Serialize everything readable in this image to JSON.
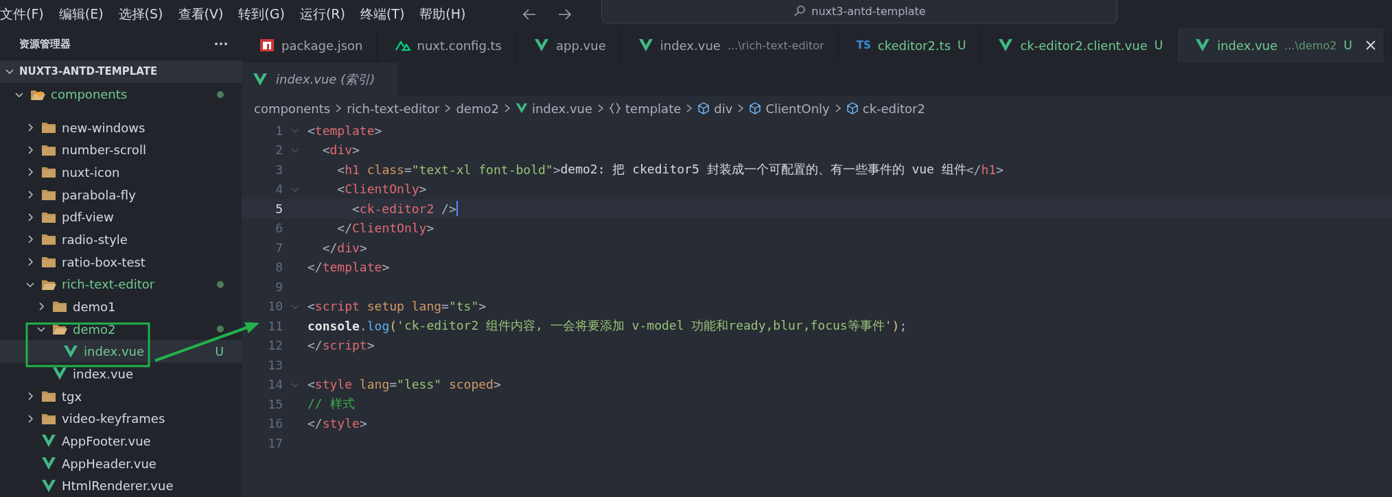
{
  "menu": [
    "文件(F)",
    "编辑(E)",
    "选择(S)",
    "查看(V)",
    "转到(G)",
    "运行(R)",
    "终端(T)",
    "帮助(H)"
  ],
  "search": {
    "value": "nuxt3-antd-template"
  },
  "sidebar": {
    "title": "资源管理器",
    "workspace": {
      "label": "NUXT3-ANTD-TEMPLATE",
      "expanded": true
    },
    "items": [
      {
        "label": "components",
        "kind": "special-folder",
        "expanded": true,
        "untracked": true,
        "dot": true,
        "selected": false,
        "children": [
          {
            "label": "new-windows",
            "kind": "folder",
            "expanded": false,
            "untracked": false,
            "selected": false
          },
          {
            "label": "number-scroll",
            "kind": "folder",
            "expanded": false,
            "untracked": false,
            "selected": false
          },
          {
            "label": "nuxt-icon",
            "kind": "folder",
            "expanded": false,
            "untracked": false,
            "selected": false
          },
          {
            "label": "parabola-fly",
            "kind": "folder",
            "expanded": false,
            "untracked": false,
            "selected": false
          },
          {
            "label": "pdf-view",
            "kind": "folder",
            "expanded": false,
            "untracked": false,
            "selected": false
          },
          {
            "label": "radio-style",
            "kind": "folder",
            "expanded": false,
            "untracked": false,
            "selected": false
          },
          {
            "label": "ratio-box-test",
            "kind": "folder",
            "expanded": false,
            "untracked": false,
            "selected": false
          },
          {
            "label": "rich-text-editor",
            "kind": "folder",
            "expanded": true,
            "untracked": true,
            "dot": true,
            "selected": false,
            "children": [
              {
                "label": "demo1",
                "kind": "folder",
                "expanded": false,
                "untracked": false,
                "selected": false
              },
              {
                "label": "demo2",
                "kind": "folder",
                "expanded": true,
                "untracked": true,
                "dot": true,
                "selected": false,
                "children": [
                  {
                    "label": "index.vue",
                    "kind": "vue",
                    "untracked": true,
                    "badge": "U",
                    "selected": true
                  }
                ]
              },
              {
                "label": "index.vue",
                "kind": "vue",
                "untracked": false,
                "selected": false
              }
            ]
          },
          {
            "label": "tgx",
            "kind": "folder",
            "expanded": false,
            "untracked": false,
            "selected": false
          },
          {
            "label": "video-keyframes",
            "kind": "folder",
            "expanded": false,
            "untracked": false,
            "selected": false
          },
          {
            "label": "AppFooter.vue",
            "kind": "vue",
            "untracked": false,
            "selected": false
          },
          {
            "label": "AppHeader.vue",
            "kind": "vue",
            "untracked": false,
            "selected": false
          },
          {
            "label": "HtmlRenderer.vue",
            "kind": "vue",
            "untracked": false,
            "selected": false
          }
        ]
      }
    ]
  },
  "tabs": [
    {
      "label": "package.json",
      "kind": "npm",
      "untracked": false,
      "selected": false
    },
    {
      "label": "nuxt.config.ts",
      "kind": "nuxt",
      "untracked": false,
      "selected": false
    },
    {
      "label": "app.vue",
      "kind": "vue",
      "untracked": false,
      "selected": false
    },
    {
      "label": "index.vue",
      "detail": "...\\rich-text-editor",
      "kind": "vue",
      "untracked": false,
      "selected": false
    },
    {
      "label": "ckeditor2.ts",
      "kind": "ts",
      "icon_text": "TS",
      "badge": "U",
      "untracked": true,
      "selected": false
    },
    {
      "label": "ck-editor2.client.vue",
      "kind": "vue",
      "badge": "U",
      "untracked": true,
      "selected": false
    },
    {
      "label": "index.vue",
      "detail": "...\\demo2",
      "kind": "vue",
      "badge": "U",
      "untracked": true,
      "selected": true
    }
  ],
  "subtab": {
    "label": "index.vue (索引)",
    "kind": "vue"
  },
  "breadcrumb": [
    {
      "label": "components"
    },
    {
      "label": "rich-text-editor"
    },
    {
      "label": "demo2"
    },
    {
      "label": "index.vue",
      "kind": "vue"
    },
    {
      "label": "template",
      "kind": "braces"
    },
    {
      "label": "div",
      "kind": "cube"
    },
    {
      "label": "ClientOnly",
      "kind": "cube"
    },
    {
      "label": "ck-editor2",
      "kind": "cube"
    }
  ],
  "code": [
    {
      "n": "1",
      "fold": true,
      "current": false,
      "tokens": [
        {
          "kind": "punct",
          "t": "<"
        },
        {
          "kind": "tag",
          "t": "template"
        },
        {
          "kind": "punct",
          "t": ">"
        }
      ]
    },
    {
      "n": "2",
      "fold": true,
      "current": false,
      "tokens": [
        {
          "kind": "punct",
          "t": "  <"
        },
        {
          "kind": "tag",
          "t": "div"
        },
        {
          "kind": "punct",
          "t": ">"
        }
      ]
    },
    {
      "n": "3",
      "fold": false,
      "current": false,
      "tokens": [
        {
          "kind": "punct",
          "t": "    <"
        },
        {
          "kind": "tag",
          "t": "h1"
        },
        {
          "kind": "attr",
          "t": " class"
        },
        {
          "kind": "punct",
          "t": "="
        },
        {
          "kind": "str",
          "t": "\"text-xl font-bold\""
        },
        {
          "kind": "punct",
          "t": ">"
        },
        {
          "kind": "text",
          "t": "demo2: 把 ckeditor5 封装成一个可配置的、有一些事件的 vue 组件"
        },
        {
          "kind": "punct",
          "t": "</"
        },
        {
          "kind": "tag",
          "t": "h1"
        },
        {
          "kind": "punct",
          "t": ">"
        }
      ]
    },
    {
      "n": "4",
      "fold": true,
      "current": false,
      "tokens": [
        {
          "kind": "punct",
          "t": "    <"
        },
        {
          "kind": "tag",
          "t": "ClientOnly"
        },
        {
          "kind": "punct",
          "t": ">"
        }
      ]
    },
    {
      "n": "5",
      "fold": false,
      "current": true,
      "tokens": [
        {
          "kind": "punct",
          "t": "      <"
        },
        {
          "kind": "tag",
          "t": "ck-editor2"
        },
        {
          "kind": "punct",
          "t": " />"
        }
      ]
    },
    {
      "n": "6",
      "fold": false,
      "current": false,
      "tokens": [
        {
          "kind": "punct",
          "t": "    </"
        },
        {
          "kind": "tag",
          "t": "ClientOnly"
        },
        {
          "kind": "punct",
          "t": ">"
        }
      ]
    },
    {
      "n": "7",
      "fold": false,
      "current": false,
      "tokens": [
        {
          "kind": "punct",
          "t": "  </"
        },
        {
          "kind": "tag",
          "t": "div"
        },
        {
          "kind": "punct",
          "t": ">"
        }
      ]
    },
    {
      "n": "8",
      "fold": false,
      "current": false,
      "tokens": [
        {
          "kind": "punct",
          "t": "</"
        },
        {
          "kind": "tag",
          "t": "template"
        },
        {
          "kind": "punct",
          "t": ">"
        }
      ]
    },
    {
      "n": "9",
      "fold": false,
      "current": false
    },
    {
      "n": "10",
      "fold": true,
      "current": false,
      "tokens": [
        {
          "kind": "punct",
          "t": "<"
        },
        {
          "kind": "tag",
          "t": "script"
        },
        {
          "kind": "attr",
          "t": " setup lang"
        },
        {
          "kind": "punct",
          "t": "="
        },
        {
          "kind": "str",
          "t": "\"ts\""
        },
        {
          "kind": "punct",
          "t": ">"
        }
      ]
    },
    {
      "n": "11",
      "fold": false,
      "current": false,
      "tokens": [
        {
          "kind": "var",
          "t": "console"
        },
        {
          "kind": "punct",
          "t": "."
        },
        {
          "kind": "fn",
          "t": "log"
        },
        {
          "kind": "paren",
          "t": "("
        },
        {
          "kind": "str",
          "t": "'ck-editor2 组件内容, 一会将要添加 v-model 功能和ready,blur,focus等事件'"
        },
        {
          "kind": "paren",
          "t": ")"
        },
        {
          "kind": "punct",
          "t": ";"
        }
      ]
    },
    {
      "n": "12",
      "fold": false,
      "current": false,
      "tokens": [
        {
          "kind": "punct",
          "t": "</"
        },
        {
          "kind": "tag",
          "t": "script"
        },
        {
          "kind": "punct",
          "t": ">"
        }
      ]
    },
    {
      "n": "13",
      "fold": false,
      "current": false
    },
    {
      "n": "14",
      "fold": true,
      "current": false,
      "tokens": [
        {
          "kind": "punct",
          "t": "<"
        },
        {
          "kind": "tag",
          "t": "style"
        },
        {
          "kind": "attr",
          "t": " lang"
        },
        {
          "kind": "punct",
          "t": "="
        },
        {
          "kind": "str",
          "t": "\"less\""
        },
        {
          "kind": "attr",
          "t": " scoped"
        },
        {
          "kind": "punct",
          "t": ">"
        }
      ]
    },
    {
      "n": "15",
      "fold": false,
      "current": false,
      "tokens": [
        {
          "kind": "comment",
          "t": "// 样式"
        }
      ]
    },
    {
      "n": "16",
      "fold": false,
      "current": false,
      "tokens": [
        {
          "kind": "punct",
          "t": "</"
        },
        {
          "kind": "tag",
          "t": "style"
        },
        {
          "kind": "punct",
          "t": ">"
        }
      ]
    },
    {
      "n": "17",
      "fold": false,
      "current": false
    }
  ]
}
